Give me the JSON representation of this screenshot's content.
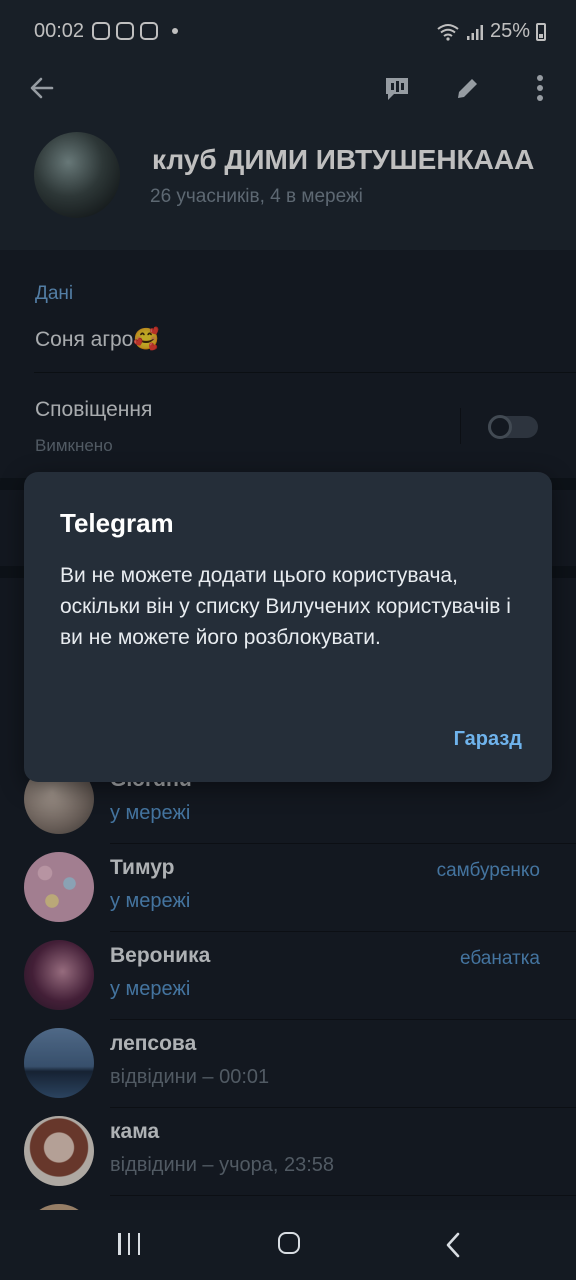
{
  "status_bar": {
    "time": "00:02",
    "battery": "25%"
  },
  "header": {
    "title": "клуб ДИМИ ИВТУШЕНКААА",
    "subtitle": "26 учасників, 4 в мережі"
  },
  "info": {
    "section_label": "Дані",
    "description": "Соня агро🥰",
    "notifications_label": "Сповіщення",
    "notifications_value": "Вимкнено"
  },
  "members": [
    {
      "name": "Giordhu",
      "status": "у мережі",
      "online": true,
      "role": ""
    },
    {
      "name": "Тимур",
      "status": "у мережі",
      "online": true,
      "role": "самбуренко"
    },
    {
      "name": "Вероника",
      "status": "у мережі",
      "online": true,
      "role": "ебанатка"
    },
    {
      "name": "лепсова",
      "status": "відвідини – 00:01",
      "online": false,
      "role": ""
    },
    {
      "name": "кама",
      "status": "відвідини – учора, 23:58",
      "online": false,
      "role": ""
    }
  ],
  "dialog": {
    "title": "Telegram",
    "message": "Ви не можете додати цього користувача, оскільки він у списку Вилучених користувачів і ви не можете його розблокувати.",
    "ok_button": "Гаразд"
  },
  "icons": [
    "back-arrow-icon",
    "video-chat-icon",
    "pencil-icon",
    "more-vert-icon",
    "wifi-icon",
    "signal-icon",
    "battery-icon"
  ],
  "colors": {
    "background": "#1a212b",
    "header": "#212a35",
    "accent": "#6fa8dc",
    "dialog": "#252e39"
  }
}
